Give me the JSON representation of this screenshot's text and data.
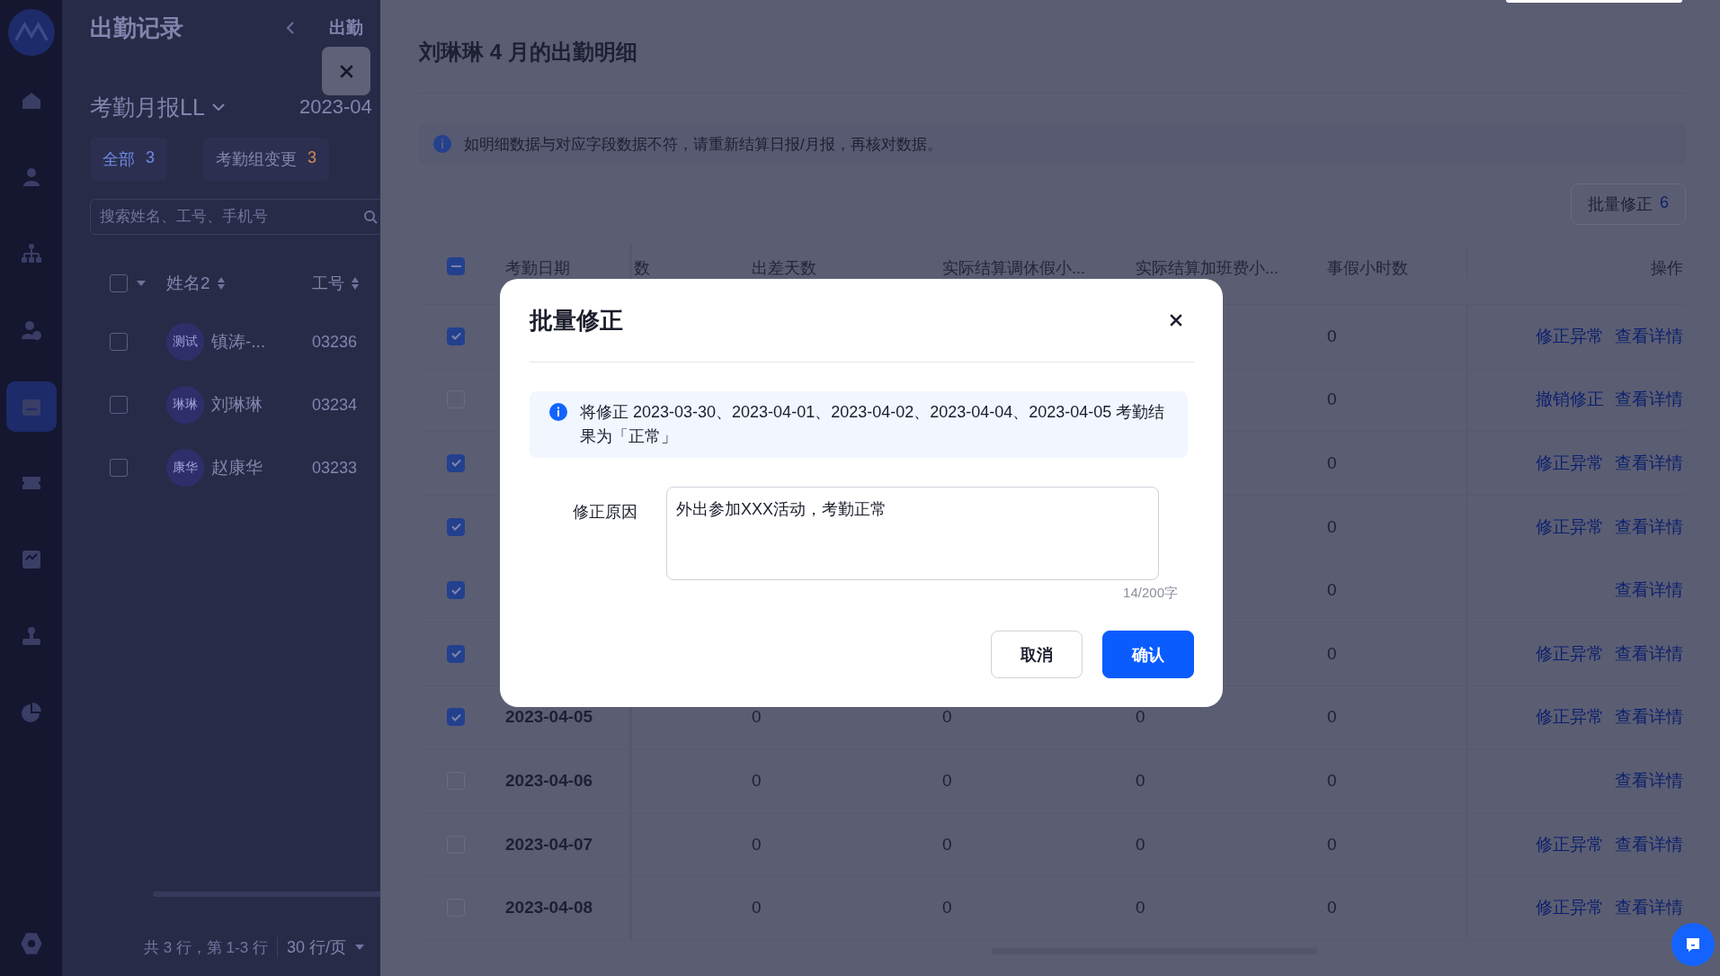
{
  "sidebar": {
    "items": [
      {
        "kind": "home",
        "selected": false
      },
      {
        "kind": "person",
        "selected": false
      },
      {
        "kind": "org",
        "selected": false
      },
      {
        "kind": "person-add",
        "selected": false
      },
      {
        "kind": "calendar",
        "selected": true
      },
      {
        "kind": "ticket",
        "selected": false
      },
      {
        "kind": "report",
        "selected": false
      },
      {
        "kind": "stamp",
        "selected": false
      },
      {
        "kind": "pie",
        "selected": false
      }
    ]
  },
  "left_page": {
    "title": "出勤记录",
    "breadcrumb": "出勤",
    "report_select": "考勤月报LL",
    "month": "2023-04",
    "tabs": [
      {
        "label": "全部",
        "count": "3",
        "selected": true
      },
      {
        "label": "考勤组变更",
        "count": "3",
        "selected": false
      }
    ],
    "search": {
      "placeholder": "搜索姓名、工号、手机号"
    },
    "table": {
      "header_checked": false,
      "columns": [
        "姓名2",
        "工号"
      ],
      "rows": [
        {
          "checked": false,
          "avatar": "测试",
          "name": "镇涛-...",
          "id": "03236"
        },
        {
          "checked": false,
          "avatar": "琳琳",
          "name": "刘琳琳",
          "id": "03234"
        },
        {
          "checked": false,
          "avatar": "康华",
          "name": "赵康华",
          "id": "03233"
        }
      ]
    },
    "footer": {
      "summary": "共 3 行，第 1-3 行",
      "page_size": "30 行/页"
    }
  },
  "drawer": {
    "title": "刘琳琳 4 月的出勤明细",
    "notice": "如明细数据与对应字段数据不符，请重新结算日报/月报，再核对数据。",
    "batch_button": {
      "label": "批量修正",
      "count": "6"
    },
    "table": {
      "header_partial": true,
      "columns": [
        "考勤日期",
        "数",
        "出差天数",
        "实际结算调休假小...",
        "实际结算加班费小...",
        "事假小时数",
        "操作"
      ],
      "rows": [
        {
          "checked": true,
          "leave_hours": "0",
          "actions": [
            "修正异常",
            "查看详情"
          ]
        },
        {
          "checked": false,
          "leave_hours": "0",
          "actions": [
            "撤销修正",
            "查看详情"
          ]
        },
        {
          "checked": true,
          "leave_hours": "0",
          "actions": [
            "修正异常",
            "查看详情"
          ]
        },
        {
          "checked": true,
          "leave_hours": "0",
          "actions": [
            "修正异常",
            "查看详情"
          ]
        },
        {
          "checked": true,
          "leave_hours": "0",
          "actions": [
            "查看详情"
          ]
        },
        {
          "checked": true,
          "leave_hours": "0",
          "actions": [
            "修正异常",
            "查看详情"
          ]
        },
        {
          "checked": true,
          "date": "2023-04-05",
          "trip_days": "0",
          "comp_hours": "0",
          "overtime_hours": "0",
          "leave_hours": "0",
          "actions": [
            "修正异常",
            "查看详情"
          ]
        },
        {
          "checked": false,
          "date": "2023-04-06",
          "trip_days": "0",
          "comp_hours": "0",
          "overtime_hours": "0",
          "leave_hours": "0",
          "actions": [
            "查看详情"
          ]
        },
        {
          "checked": false,
          "date": "2023-04-07",
          "trip_days": "0",
          "comp_hours": "0",
          "overtime_hours": "0",
          "leave_hours": "0",
          "actions": [
            "修正异常",
            "查看详情"
          ]
        },
        {
          "checked": false,
          "date": "2023-04-08",
          "trip_days": "0",
          "comp_hours": "0",
          "overtime_hours": "0",
          "leave_hours": "0",
          "actions": [
            "修正异常",
            "查看详情"
          ]
        }
      ]
    }
  },
  "modal": {
    "title": "批量修正",
    "notice": "将修正 2023-03-30、2023-04-01、2023-04-02、2023-04-04、2023-04-05 考勤结果为「正常」",
    "reason_label": "修正原因",
    "reason_value": "外出参加XXX活动，考勤正常",
    "counter": "14/200字",
    "buttons": [
      {
        "label": "取消",
        "kind": "secondary"
      },
      {
        "label": "确认",
        "kind": "primary"
      }
    ]
  }
}
